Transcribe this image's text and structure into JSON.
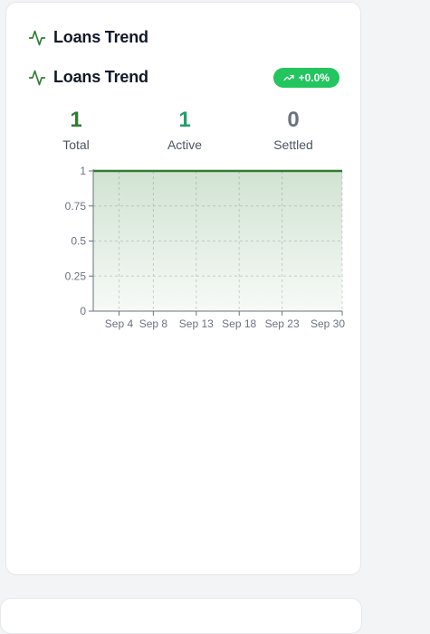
{
  "card": {
    "heading": "Loans Trend",
    "subheading": "Loans Trend",
    "badge": "+0.0%",
    "icons": {
      "heading": "activity-icon",
      "badge": "trending-up-icon"
    },
    "colors": {
      "accent": "#2e7d32",
      "badge": "#22c55e",
      "active": "#22a06b",
      "muted": "#6b7280"
    }
  },
  "stats": [
    {
      "value": "1",
      "label": "Total"
    },
    {
      "value": "1",
      "label": "Active"
    },
    {
      "value": "0",
      "label": "Settled"
    }
  ],
  "chart_data": {
    "type": "area",
    "x_ticks": [
      "Sep 4",
      "Sep 8",
      "Sep 13",
      "Sep 18",
      "Sep 23",
      "Sep 30"
    ],
    "y_ticks": [
      "0",
      "0.25",
      "0.5",
      "0.75",
      "1"
    ],
    "ylim": [
      0,
      1
    ],
    "series": [
      {
        "x": [
          "Sep 1",
          "Sep 30"
        ],
        "values": [
          1,
          1
        ]
      }
    ],
    "grid": true,
    "color": "#2e7d32"
  }
}
